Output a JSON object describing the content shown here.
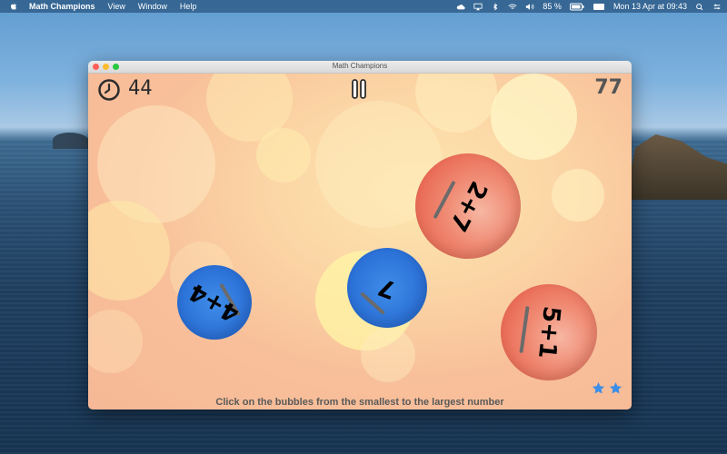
{
  "menubar": {
    "app_name": "Math Champions",
    "menus": [
      "View",
      "Window",
      "Help"
    ],
    "battery": "85 %",
    "datetime": "Mon 13 Apr at  09:43"
  },
  "window": {
    "title": "Math Champions"
  },
  "game": {
    "time_left": "44",
    "score": "77",
    "instruction": "Click on the bubbles from the smallest to the largest number",
    "stars_count": 2,
    "bubbles": [
      {
        "id": "bubble-2-plus-7",
        "expression": "2+7",
        "color": "red"
      },
      {
        "id": "bubble-4-plus-4",
        "expression": "4+4",
        "color": "blue"
      },
      {
        "id": "bubble-7",
        "expression": "7",
        "color": "blue"
      },
      {
        "id": "bubble-5-plus-1",
        "expression": "5+1",
        "color": "red"
      }
    ]
  },
  "colors": {
    "red_bubble": "#e86651",
    "blue_bubble": "#2a6fd6",
    "star": "#3d8ee6"
  }
}
